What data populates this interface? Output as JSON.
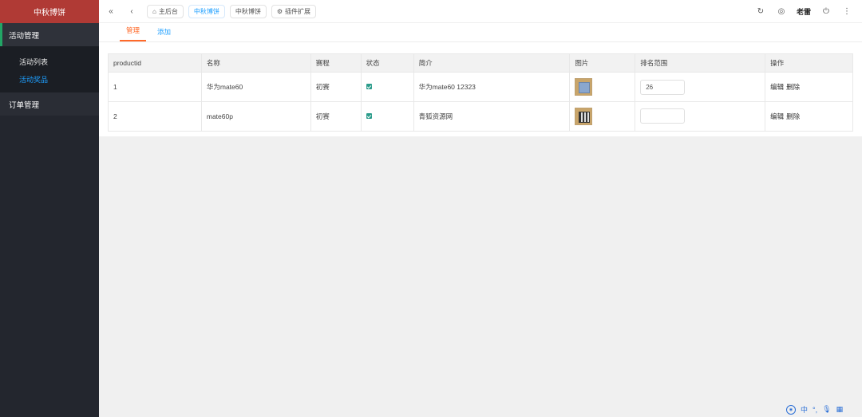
{
  "sidebar": {
    "brand": "中秋博饼",
    "groups": [
      {
        "label": "活动管理"
      },
      {
        "label": "订单管理"
      }
    ],
    "submenu": [
      {
        "label": "活动列表"
      },
      {
        "label": "活动奖品"
      }
    ]
  },
  "header": {
    "tabs": [
      {
        "label": "主后台"
      },
      {
        "label": "中秋博饼"
      },
      {
        "label": "中秋博饼"
      },
      {
        "label": "插件扩展"
      }
    ],
    "username": "老雷"
  },
  "subtabs": [
    "管理",
    "添加"
  ],
  "table": {
    "columns": [
      "productid",
      "名称",
      "赛程",
      "状态",
      "简介",
      "图片",
      "排名范围",
      "操作"
    ],
    "rows": [
      {
        "productid": "1",
        "name": "华为mate60",
        "stage": "初赛",
        "intro": "华为mate60 12323",
        "rank": "26",
        "edit": "编辑",
        "delete": "删除"
      },
      {
        "productid": "2",
        "name": "mate60p",
        "stage": "初赛",
        "intro": "青狐资源网",
        "rank": "",
        "edit": "编辑",
        "delete": "删除"
      }
    ]
  },
  "ime": {
    "lang": "中"
  },
  "colors": {
    "brand": "#b03a35",
    "accent": "#1e9fff",
    "active_tab": "#ff6a2a",
    "sidebar": "#23262e"
  }
}
